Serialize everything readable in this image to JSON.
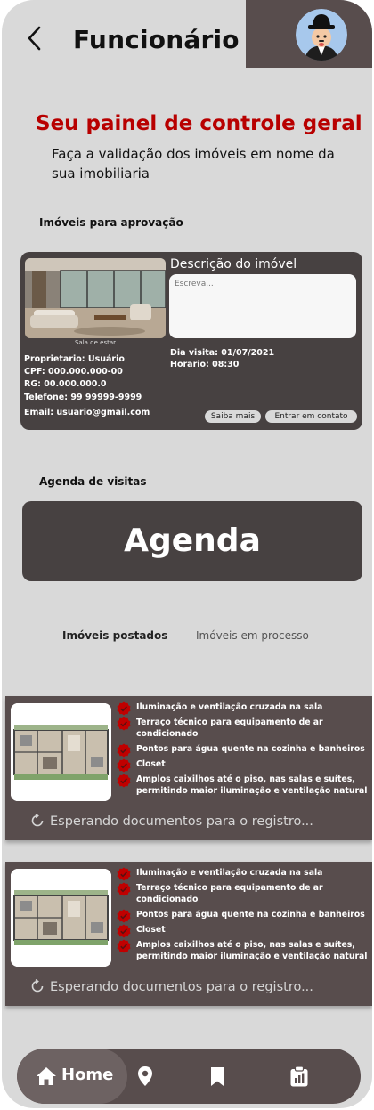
{
  "header": {
    "title": "Funcionário",
    "back_icon": "chevron-left-icon",
    "avatar_icon": "user-avatar-icon"
  },
  "intro": {
    "headline": "Seu painel de controle geral",
    "subheadline": "Faça a validação dos imóveis em nome da sua imobiliaria"
  },
  "approval": {
    "section_label": "Imóveis para aprovação",
    "photo_caption": "Sala de estar",
    "owner_lines": [
      "Proprietario: Usuário",
      "CPF: 000.000.000-00",
      "RG: 00.000.000.0",
      "Telefone: 99 99999-9999"
    ],
    "email": "Email: usuario@gmail.com",
    "description_title": "Descrição  do imóvel",
    "description_placeholder": "Escreva...",
    "visit_date": "Dia visita: 01/07/2021",
    "visit_time": "Horario: 08:30",
    "learn_more_label": "Saiba mais",
    "contact_label": "Entrar em contato"
  },
  "schedule": {
    "section_label": "Agenda de visitas",
    "button_label": "Agenda"
  },
  "tabs": [
    {
      "label": "Imóveis postados",
      "active": true
    },
    {
      "label": "Imóveis em processo",
      "active": false
    }
  ],
  "properties": [
    {
      "features": [
        "Iluminação e ventilação cruzada na sala",
        "Terraço técnico para equipamento de ar condicionado",
        "Pontos para água quente na cozinha e banheiros",
        "Closet",
        "Amplos caixilhos até o piso, nas salas e suítes, permitindo maior iluminação e ventilação natural"
      ],
      "status": "Esperando documentos para o registro..."
    },
    {
      "features": [
        "Iluminação e ventilação cruzada na sala",
        "Terraço técnico para equipamento de ar condicionado",
        "Pontos para água quente na cozinha e banheiros",
        "Closet",
        "Amplos caixilhos até o piso, nas salas e suítes, permitindo maior iluminação e ventilação natural"
      ],
      "status": "Esperando documentos para o registro..."
    }
  ],
  "nav": {
    "home_label": "Home",
    "icons": [
      "home-icon",
      "location-pin-icon",
      "bookmark-icon",
      "clipboard-chart-icon"
    ]
  },
  "colors": {
    "background": "#d9d9d9",
    "card_dark": "#474141",
    "card_brown": "#584d4d",
    "headline_red": "#b80000",
    "check_red": "#c00000"
  }
}
